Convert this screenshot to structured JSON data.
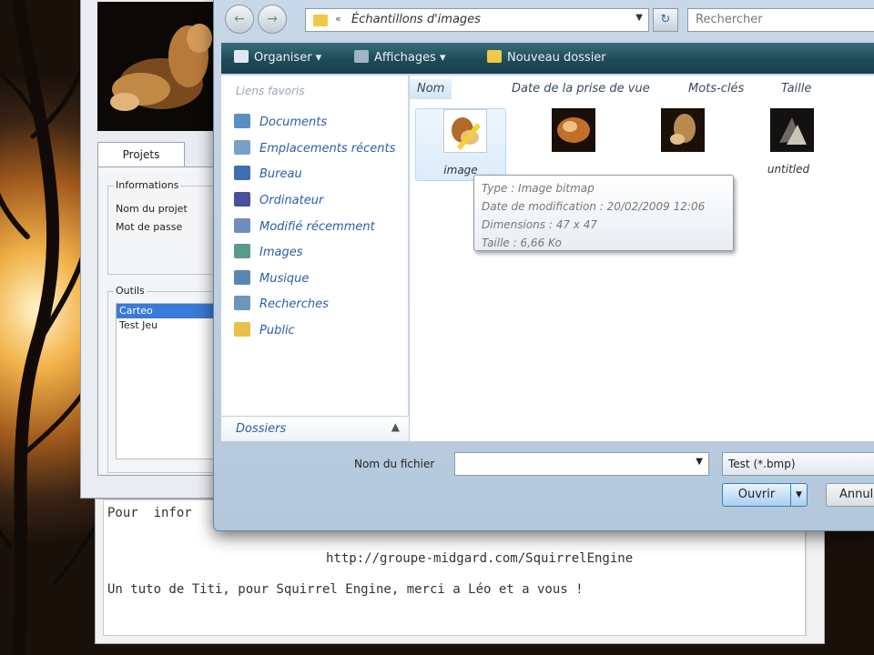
{
  "app": {
    "tabs": [
      {
        "label": "Projets"
      }
    ],
    "info_group": {
      "title": "Informations",
      "fields": [
        "Nom du projet",
        "Mot de passe"
      ]
    },
    "tools_group": {
      "title": "Outils",
      "items": [
        {
          "label": "Carteo",
          "selected": true
        },
        {
          "label": "Test Jeu",
          "selected": false
        }
      ]
    }
  },
  "console": {
    "lines": [
      "Pour  infor",
      "http://groupe-midgard.com/SquirrelEngine",
      "Un tuto de Titi, pour Squirrel Engine, merci a Léo et a vous !"
    ]
  },
  "dialog": {
    "address": {
      "path": "Échantillons d'images"
    },
    "search": {
      "placeholder": "Rechercher"
    },
    "toolbar": {
      "organize": "Organiser",
      "display": "Affichages",
      "new_folder": "Nouveau dossier"
    },
    "sidebar": {
      "header": "Liens favoris",
      "items": [
        {
          "label": "Documents",
          "icon": "documents-icon",
          "color": "#5a8fc0"
        },
        {
          "label": "Emplacements récents",
          "icon": "recent-places-icon",
          "color": "#7aa0c8"
        },
        {
          "label": "Bureau",
          "icon": "desktop-icon",
          "color": "#3f6fb0"
        },
        {
          "label": "Ordinateur",
          "icon": "computer-icon",
          "color": "#4a4f9a"
        },
        {
          "label": "Modifié récemment",
          "icon": "recently-changed-icon",
          "color": "#6d8fb8"
        },
        {
          "label": "Images",
          "icon": "pictures-icon",
          "color": "#5a9a8c"
        },
        {
          "label": "Musique",
          "icon": "music-icon",
          "color": "#5a86b4"
        },
        {
          "label": "Recherches",
          "icon": "searches-icon",
          "color": "#6c96ba"
        },
        {
          "label": "Public",
          "icon": "public-folder-icon",
          "color": "#e8c04a"
        }
      ],
      "folders_label": "Dossiers"
    },
    "columns": [
      "Nom",
      "Date de la prise de vue",
      "Mots-clés",
      "Taille"
    ],
    "files": [
      {
        "label": "image",
        "thumb": "#e9c07a"
      },
      {
        "label": "",
        "thumb": "#c0702a"
      },
      {
        "label": "",
        "thumb": "#b88a50"
      },
      {
        "label": "untitled",
        "thumb": "#6a6a60"
      }
    ],
    "tooltip": {
      "type": "Type : Image bitmap",
      "modified": "Date de modification : 20/02/2009 12:06",
      "dimensions": "Dimensions : 47 x 47",
      "size": "Taille : 6,66 Ko"
    },
    "filename": {
      "label": "Nom du fichier",
      "value": ""
    },
    "filetype": {
      "value": "Test (*.bmp)"
    },
    "buttons": {
      "open": "Ouvrir",
      "cancel": "Annuler"
    }
  }
}
